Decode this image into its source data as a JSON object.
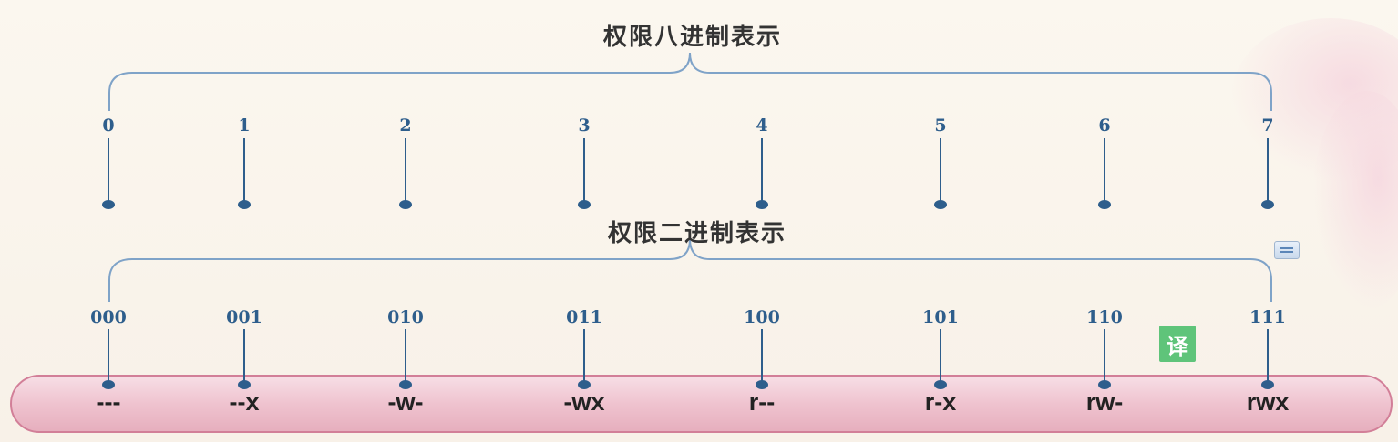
{
  "octal_title": "权限八进制表示",
  "binary_title": "权限二进制表示",
  "octal_values": [
    "0",
    "1",
    "2",
    "3",
    "4",
    "5",
    "6",
    "7"
  ],
  "binary_values": [
    "000",
    "001",
    "010",
    "011",
    "100",
    "101",
    "110",
    "111"
  ],
  "permissions": [
    "---",
    "--x",
    "-w-",
    "-wx",
    "r--",
    "r-x",
    "rw-",
    "rwx"
  ],
  "translate_badge": "译",
  "colors": {
    "accent_blue": "#2e5e8c",
    "brace_blue": "#7fa3c8",
    "pill_pink": "#f1c9d4",
    "pill_border": "#d27f98"
  }
}
